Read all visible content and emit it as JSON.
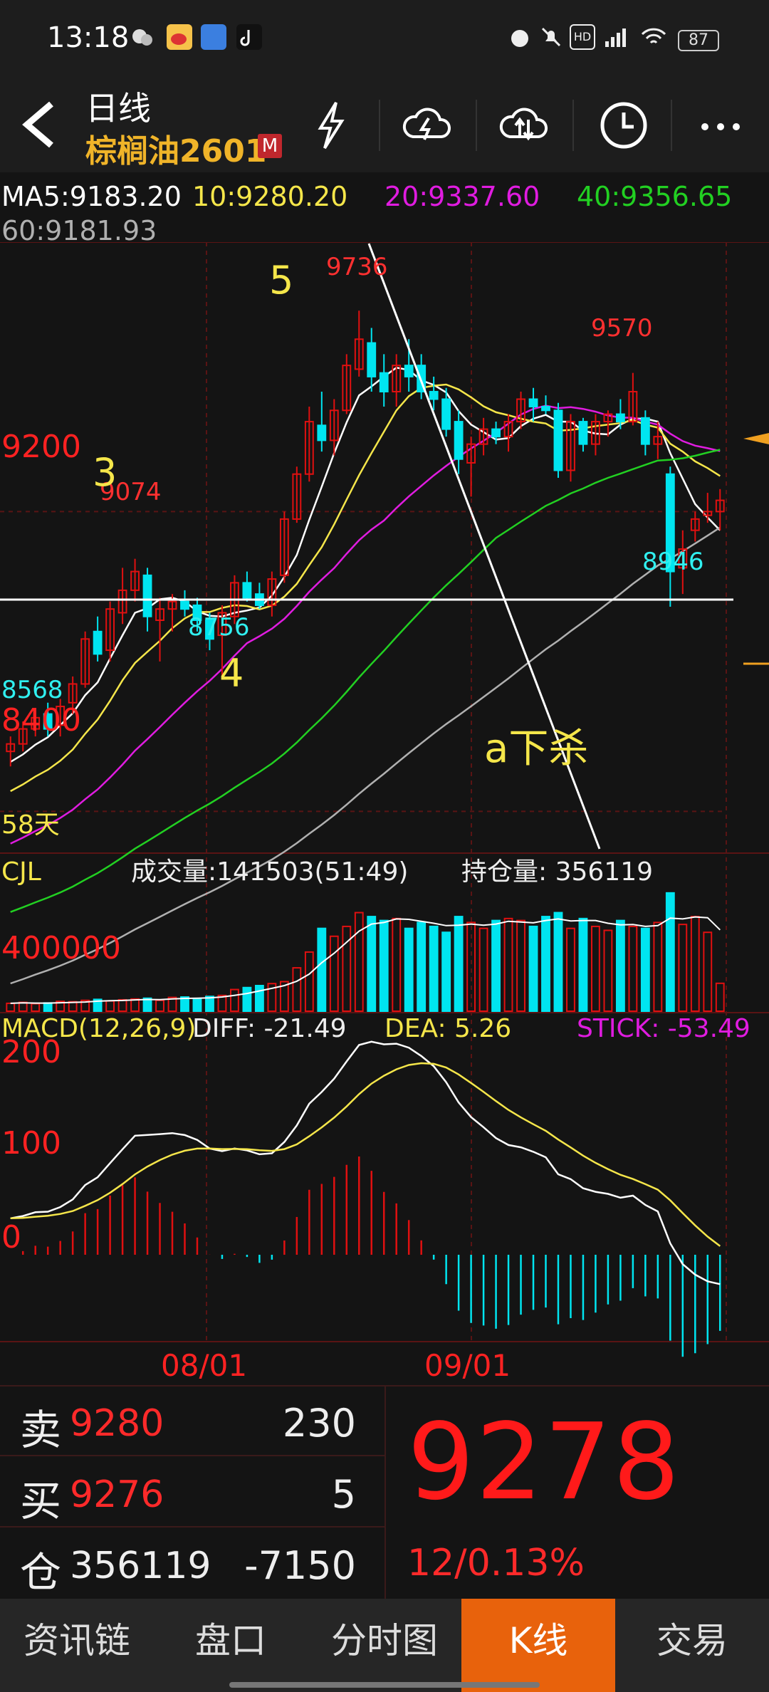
{
  "status_bar": {
    "time": "13:18",
    "battery": "87"
  },
  "header": {
    "period": "日线",
    "instrument": "棕榈油2601",
    "badge": "M",
    "icons": [
      "back-arrow-icon",
      "lightning-icon",
      "cloud-lightning-icon",
      "cloud-sync-icon",
      "clock-icon",
      "more-icon"
    ]
  },
  "ma": {
    "ma5": "MA5:9183.20",
    "ma10": "10:9280.20",
    "ma20": "20:9337.60",
    "ma40": "40:9356.65",
    "ma60": "60:9181.93"
  },
  "colors": {
    "up": "#e01010",
    "down": "#00e5f0",
    "ma5": "#ffffff",
    "ma10": "#f5e64a",
    "ma20": "#e01ce0",
    "ma40": "#22d022",
    "ma60": "#b0b0b0",
    "annotation": "#f5e64a",
    "accent": "#e8620c"
  },
  "chart": {
    "y_labels": [
      "9200",
      "8400"
    ],
    "price_annotations": [
      "9736",
      "9074",
      "9570",
      "8946",
      "8756",
      "8568"
    ],
    "wave_labels": [
      "5",
      "3",
      "4"
    ],
    "note_text": "a下杀",
    "days_label": "58天"
  },
  "volume": {
    "title": "CJL",
    "volume_text": "成交量:141503(51:49)",
    "oi_text": "持仓量: 356119",
    "y_label": "400000"
  },
  "macd": {
    "title": "MACD(12,26,9)",
    "diff": "DIFF: -21.49",
    "dea": "DEA: 5.26",
    "stick": "STICK: -53.49",
    "y_labels": [
      "200",
      "100",
      "0"
    ]
  },
  "x_labels": [
    "08/01",
    "09/01"
  ],
  "quote": {
    "sell_label": "卖",
    "sell_price": "9280",
    "sell_vol": "230",
    "buy_label": "买",
    "buy_price": "9276",
    "buy_vol": "5",
    "oi_label": "仓",
    "oi_value": "356119",
    "oi_change": "-7150",
    "last_price": "9278",
    "change": "12/0.13%"
  },
  "tabs": [
    "资讯链",
    "盘口",
    "分时图",
    "K线",
    "交易"
  ],
  "active_tab": "K线",
  "chart_data": {
    "type": "candlestick",
    "title": "棕榈油2601 日线",
    "y_range": [
      8300,
      9900
    ],
    "candles": [
      {
        "o": 8560,
        "h": 8600,
        "l": 8520,
        "c": 8580
      },
      {
        "o": 8580,
        "h": 8640,
        "l": 8560,
        "c": 8620
      },
      {
        "o": 8620,
        "h": 8670,
        "l": 8600,
        "c": 8650
      },
      {
        "o": 8660,
        "h": 8690,
        "l": 8600,
        "c": 8620
      },
      {
        "o": 8630,
        "h": 8700,
        "l": 8600,
        "c": 8680
      },
      {
        "o": 8690,
        "h": 8760,
        "l": 8660,
        "c": 8740
      },
      {
        "o": 8740,
        "h": 8880,
        "l": 8730,
        "c": 8860
      },
      {
        "o": 8880,
        "h": 8920,
        "l": 8800,
        "c": 8820
      },
      {
        "o": 8830,
        "h": 8960,
        "l": 8800,
        "c": 8940
      },
      {
        "o": 8930,
        "h": 9050,
        "l": 8900,
        "c": 8990
      },
      {
        "o": 8990,
        "h": 9074,
        "l": 8960,
        "c": 9040
      },
      {
        "o": 9030,
        "h": 9050,
        "l": 8880,
        "c": 8920
      },
      {
        "o": 8910,
        "h": 8970,
        "l": 8800,
        "c": 8940
      },
      {
        "o": 8940,
        "h": 8980,
        "l": 8880,
        "c": 8960
      },
      {
        "o": 8960,
        "h": 8990,
        "l": 8920,
        "c": 8940
      },
      {
        "o": 8950,
        "h": 8970,
        "l": 8880,
        "c": 8910
      },
      {
        "o": 8910,
        "h": 8930,
        "l": 8830,
        "c": 8860
      },
      {
        "o": 8870,
        "h": 8950,
        "l": 8756,
        "c": 8930
      },
      {
        "o": 8920,
        "h": 9030,
        "l": 8900,
        "c": 9010
      },
      {
        "o": 9010,
        "h": 9040,
        "l": 8960,
        "c": 8970
      },
      {
        "o": 8980,
        "h": 9010,
        "l": 8940,
        "c": 8950
      },
      {
        "o": 8950,
        "h": 9040,
        "l": 8920,
        "c": 9020
      },
      {
        "o": 9030,
        "h": 9200,
        "l": 9010,
        "c": 9180
      },
      {
        "o": 9180,
        "h": 9320,
        "l": 9170,
        "c": 9300
      },
      {
        "o": 9300,
        "h": 9480,
        "l": 9280,
        "c": 9440
      },
      {
        "o": 9430,
        "h": 9520,
        "l": 9360,
        "c": 9390
      },
      {
        "o": 9390,
        "h": 9500,
        "l": 9350,
        "c": 9470
      },
      {
        "o": 9470,
        "h": 9620,
        "l": 9460,
        "c": 9590
      },
      {
        "o": 9580,
        "h": 9736,
        "l": 9560,
        "c": 9660
      },
      {
        "o": 9650,
        "h": 9690,
        "l": 9520,
        "c": 9560
      },
      {
        "o": 9570,
        "h": 9620,
        "l": 9480,
        "c": 9520
      },
      {
        "o": 9520,
        "h": 9620,
        "l": 9480,
        "c": 9590
      },
      {
        "o": 9590,
        "h": 9660,
        "l": 9520,
        "c": 9560
      },
      {
        "o": 9590,
        "h": 9620,
        "l": 9500,
        "c": 9520
      },
      {
        "o": 9520,
        "h": 9560,
        "l": 9470,
        "c": 9500
      },
      {
        "o": 9500,
        "h": 9530,
        "l": 9400,
        "c": 9420
      },
      {
        "o": 9440,
        "h": 9470,
        "l": 9300,
        "c": 9340
      },
      {
        "o": 9330,
        "h": 9400,
        "l": 9240,
        "c": 9380
      },
      {
        "o": 9380,
        "h": 9450,
        "l": 9350,
        "c": 9420
      },
      {
        "o": 9420,
        "h": 9440,
        "l": 9380,
        "c": 9400
      },
      {
        "o": 9400,
        "h": 9460,
        "l": 9360,
        "c": 9440
      },
      {
        "o": 9440,
        "h": 9520,
        "l": 9420,
        "c": 9500
      },
      {
        "o": 9500,
        "h": 9530,
        "l": 9440,
        "c": 9480
      },
      {
        "o": 9480,
        "h": 9510,
        "l": 9460,
        "c": 9470
      },
      {
        "o": 9470,
        "h": 9490,
        "l": 9290,
        "c": 9310
      },
      {
        "o": 9310,
        "h": 9460,
        "l": 9280,
        "c": 9440
      },
      {
        "o": 9440,
        "h": 9450,
        "l": 9360,
        "c": 9380
      },
      {
        "o": 9380,
        "h": 9460,
        "l": 9350,
        "c": 9440
      },
      {
        "o": 9440,
        "h": 9470,
        "l": 9400,
        "c": 9460
      },
      {
        "o": 9460,
        "h": 9500,
        "l": 9420,
        "c": 9440
      },
      {
        "o": 9440,
        "h": 9570,
        "l": 9430,
        "c": 9520
      },
      {
        "o": 9450,
        "h": 9470,
        "l": 9350,
        "c": 9380
      },
      {
        "o": 9380,
        "h": 9440,
        "l": 9340,
        "c": 9400
      },
      {
        "o": 9300,
        "h": 9320,
        "l": 8946,
        "c": 9040
      },
      {
        "o": 9050,
        "h": 9150,
        "l": 8980,
        "c": 9100
      },
      {
        "o": 9150,
        "h": 9200,
        "l": 9120,
        "c": 9180
      },
      {
        "o": 9190,
        "h": 9250,
        "l": 9170,
        "c": 9200
      },
      {
        "o": 9200,
        "h": 9260,
        "l": 9150,
        "c": 9230
      }
    ],
    "volume_ylabel": "400000",
    "volumes": [
      40000,
      45000,
      38000,
      42000,
      50000,
      48000,
      55000,
      60000,
      52000,
      58000,
      62000,
      66000,
      55000,
      70000,
      72000,
      65000,
      75000,
      80000,
      110000,
      120000,
      130000,
      140000,
      150000,
      220000,
      300000,
      420000,
      380000,
      430000,
      500000,
      480000,
      460000,
      470000,
      420000,
      450000,
      430000,
      400000,
      480000,
      450000,
      420000,
      460000,
      470000,
      460000,
      430000,
      480000,
      500000,
      420000,
      470000,
      430000,
      410000,
      460000,
      430000,
      420000,
      450000,
      600000,
      440000,
      480000,
      400000,
      141503
    ],
    "macd_labels": [
      "200",
      "100",
      "0"
    ]
  }
}
